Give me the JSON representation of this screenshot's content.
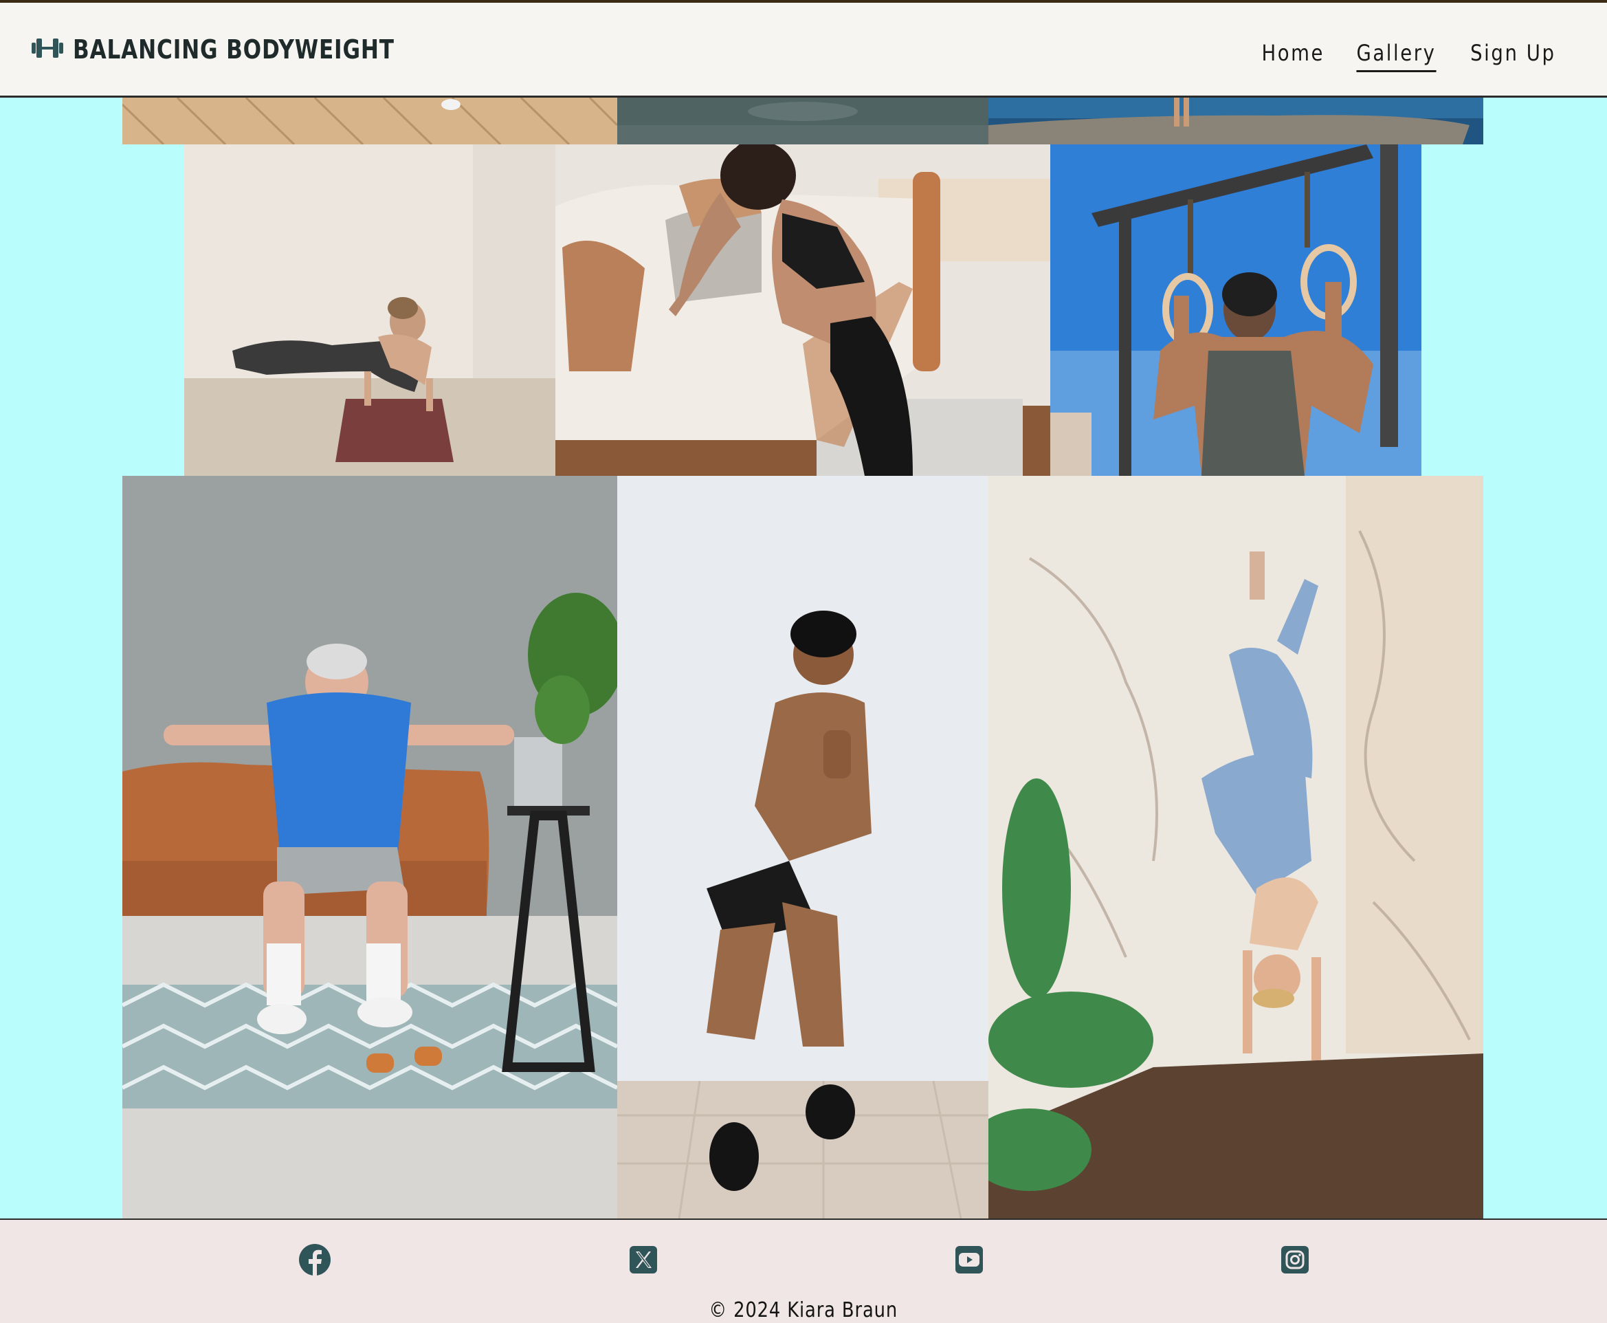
{
  "header": {
    "brand": "BALANCING BODYWEIGHT",
    "brand_icon": "dumbbell-icon",
    "nav": [
      {
        "label": "Home",
        "active": false
      },
      {
        "label": "Gallery",
        "active": true
      },
      {
        "label": "Sign Up",
        "active": false
      }
    ]
  },
  "gallery": {
    "images": [
      {
        "name": "photo-wood-floor"
      },
      {
        "name": "photo-grey-surface"
      },
      {
        "name": "photo-seaside-rock"
      },
      {
        "name": "photo-yoga-arm-balance"
      },
      {
        "name": "photo-couch-incline-pushup"
      },
      {
        "name": "photo-gymnastic-rings"
      },
      {
        "name": "photo-senior-squat"
      },
      {
        "name": "photo-man-squat"
      },
      {
        "name": "photo-wall-handstand"
      }
    ]
  },
  "footer": {
    "social": [
      "facebook-icon",
      "x-icon",
      "youtube-icon",
      "instagram-icon"
    ],
    "copyright": "© 2024 Kiara Braun"
  },
  "colors": {
    "page_background": "#b9fdfd",
    "header_background": "#f7f5f2",
    "footer_background": "#f1e6e6",
    "icon_color": "#2f5559"
  }
}
